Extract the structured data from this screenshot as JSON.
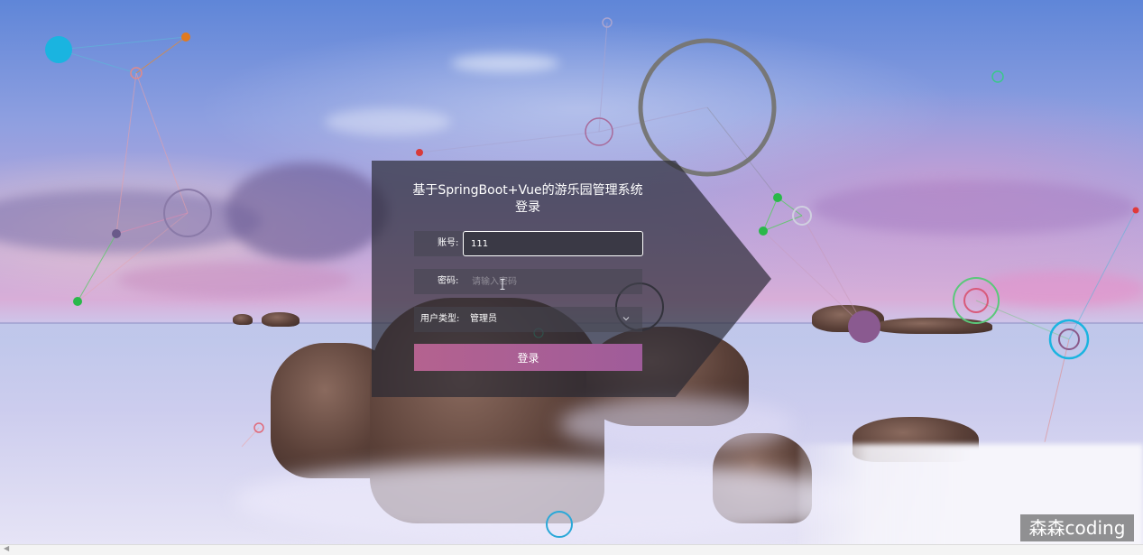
{
  "login": {
    "title": "基于SpringBoot+Vue的游乐园管理系统登录",
    "account_label": "账号:",
    "account_value": "111",
    "password_label": "密码:",
    "password_placeholder": "请输入密码",
    "user_type_label": "用户类型:",
    "user_type_value": "管理员",
    "submit_label": "登录"
  },
  "watermark": {
    "text": "森森coding"
  },
  "colors": {
    "panel_background": "#28283280",
    "button_gradient_start": "#b4628f",
    "button_gradient_end": "#9f5c9a",
    "text": "#ffffff"
  },
  "icons": {
    "select_arrow": "chevron-down-icon",
    "text_cursor": "i-beam-cursor-icon"
  }
}
